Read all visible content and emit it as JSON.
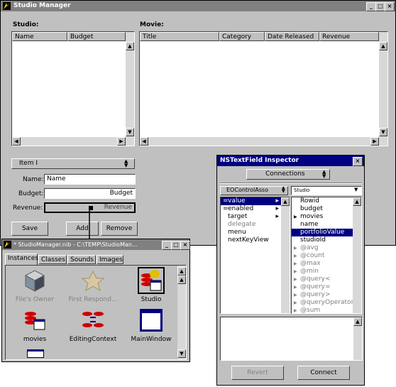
{
  "main_window": {
    "title": "Studio Manager",
    "studio_label": "Studio:",
    "movie_label": "Movie:",
    "studio_columns": [
      "Name",
      "Budget"
    ],
    "movie_columns": [
      "Title",
      "Category",
      "Date Released",
      "Revenue"
    ],
    "popup_value": "Item I",
    "name_label": "Name:",
    "name_value": "Name",
    "budget_label": "Budget:",
    "budget_value": "Budget",
    "revenue_label": "Revenue:",
    "revenue_value": "Revenue",
    "save_button": "Save",
    "add_button": "Add",
    "remove_button": "Remove"
  },
  "nib_window": {
    "title": "* StudioManager.nib  -  C:\\TEMP\\StudioMan...",
    "tabs": [
      "Instances",
      "Classes",
      "Sounds",
      "Images"
    ],
    "icons": [
      {
        "label": "File's Owner",
        "icon": "files-owner-cube-icon",
        "dimmed": true
      },
      {
        "label": "First Respond...",
        "icon": "first-responder-icon",
        "dimmed": true
      },
      {
        "label": "Studio",
        "icon": "studio-display-group-icon",
        "dimmed": false
      },
      {
        "label": "movies",
        "icon": "movies-display-group-icon",
        "dimmed": false
      },
      {
        "label": "EditingContext",
        "icon": "editing-context-icon",
        "dimmed": false
      },
      {
        "label": "MainWindow",
        "icon": "window-icon",
        "dimmed": false
      }
    ]
  },
  "inspector": {
    "title": "NSTextField Inspector",
    "mode_popup": "Connections",
    "left_popup": "EOControlAsso",
    "right_popup": "Studio",
    "outlets": [
      {
        "label": "value",
        "mark": "=",
        "arrow": true,
        "selected": true,
        "dimmed": false
      },
      {
        "label": "enabled",
        "mark": "=",
        "arrow": true,
        "selected": false,
        "dimmed": false
      },
      {
        "label": "target",
        "mark": "",
        "arrow": true,
        "selected": false,
        "dimmed": false
      },
      {
        "label": "delegate",
        "mark": "",
        "arrow": false,
        "selected": false,
        "dimmed": true
      },
      {
        "label": "menu",
        "mark": "",
        "arrow": false,
        "selected": false,
        "dimmed": false
      },
      {
        "label": "nextKeyView",
        "mark": "",
        "arrow": false,
        "selected": false,
        "dimmed": false
      }
    ],
    "keys": [
      {
        "label": "Rowid",
        "tri": false,
        "selected": false,
        "dimmed": false
      },
      {
        "label": "budget",
        "tri": false,
        "selected": false,
        "dimmed": false
      },
      {
        "label": "movies",
        "tri": true,
        "selected": false,
        "dimmed": false
      },
      {
        "label": "name",
        "tri": false,
        "selected": false,
        "dimmed": false
      },
      {
        "label": "portfolioValue",
        "tri": false,
        "selected": true,
        "dimmed": false
      },
      {
        "label": "studioId",
        "tri": false,
        "selected": false,
        "dimmed": false
      },
      {
        "label": "@avg",
        "tri": true,
        "selected": false,
        "dimmed": true
      },
      {
        "label": "@count",
        "tri": true,
        "selected": false,
        "dimmed": true
      },
      {
        "label": "@max",
        "tri": true,
        "selected": false,
        "dimmed": true
      },
      {
        "label": "@min",
        "tri": true,
        "selected": false,
        "dimmed": true
      },
      {
        "label": "@query<",
        "tri": true,
        "selected": false,
        "dimmed": true
      },
      {
        "label": "@query=",
        "tri": true,
        "selected": false,
        "dimmed": true
      },
      {
        "label": "@query>",
        "tri": true,
        "selected": false,
        "dimmed": true
      },
      {
        "label": "@queryOperator",
        "tri": true,
        "selected": false,
        "dimmed": true
      },
      {
        "label": "@sum",
        "tri": true,
        "selected": false,
        "dimmed": true
      }
    ],
    "revert_button": "Revert",
    "connect_button": "Connect"
  },
  "colors": {
    "window_bg": "#c0c0c0",
    "active_title": "#000080",
    "inactive_title": "#808080",
    "selection": "#000080"
  }
}
